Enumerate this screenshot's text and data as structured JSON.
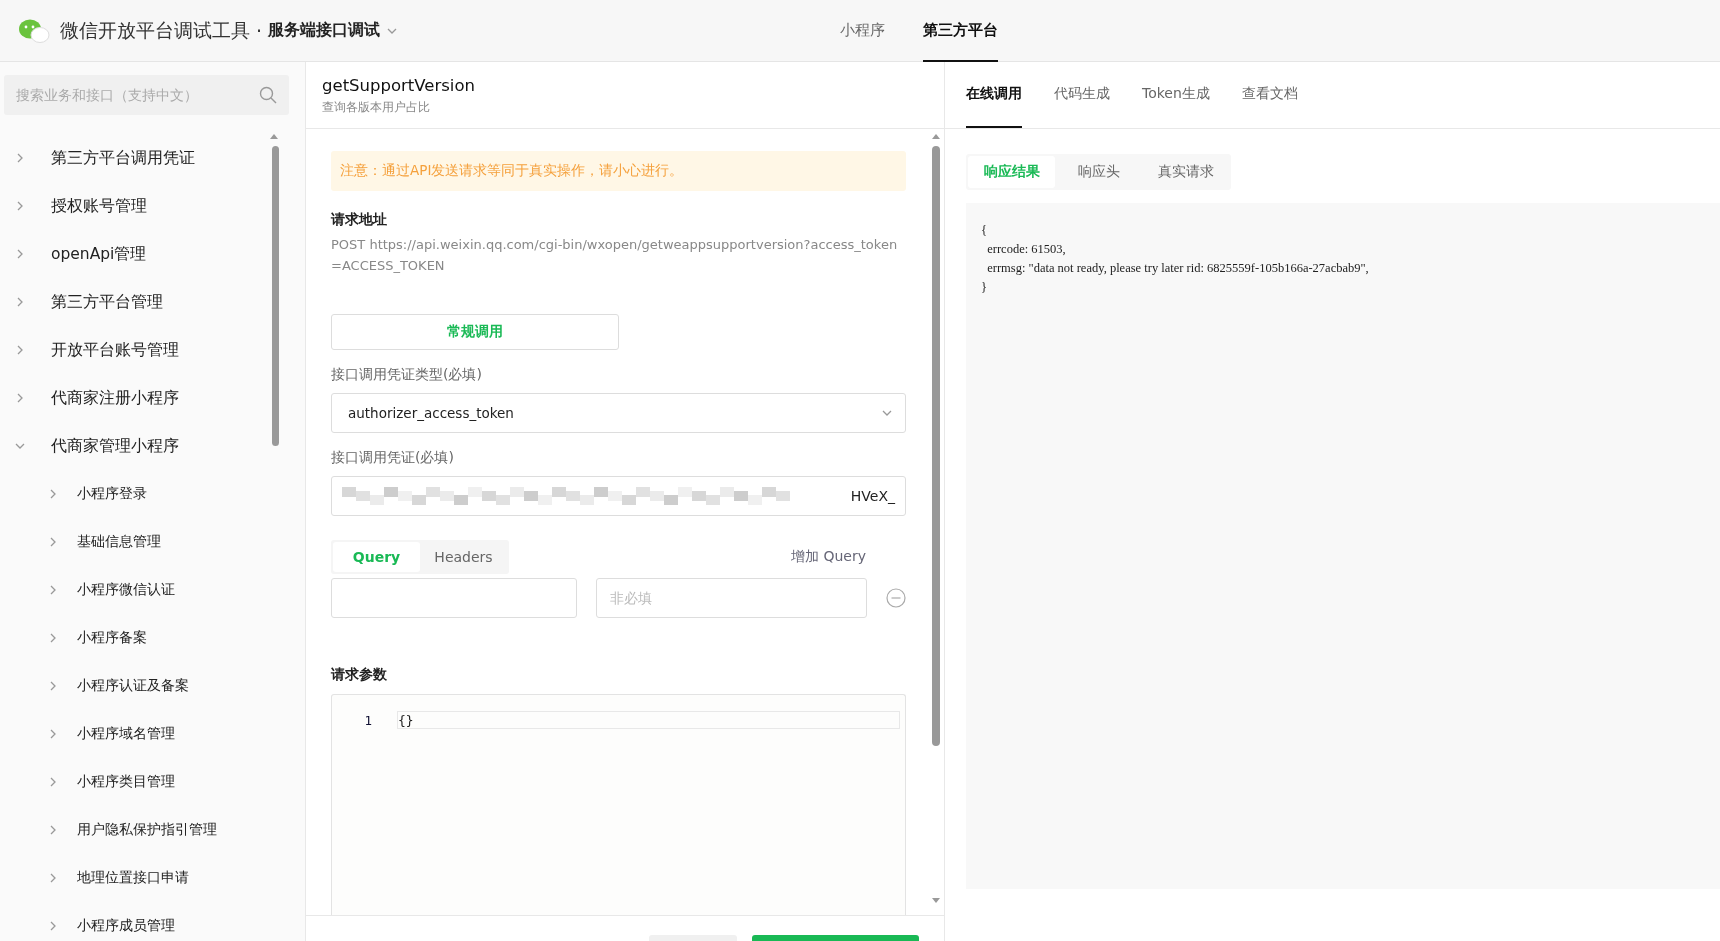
{
  "header": {
    "app_title": "微信开放平台调试工具",
    "separator": "·",
    "section": "服务端接口调试",
    "nav": [
      {
        "label": "小程序",
        "selected": false
      },
      {
        "label": "第三方平台",
        "selected": true
      }
    ]
  },
  "sidebar": {
    "search": {
      "placeholder": "搜索业务和接口（支持中文）"
    },
    "items": [
      {
        "label": "第三方平台调用凭证",
        "expanded": false
      },
      {
        "label": "授权账号管理",
        "expanded": false
      },
      {
        "label": "openApi管理",
        "expanded": false
      },
      {
        "label": "第三方平台管理",
        "expanded": false
      },
      {
        "label": "开放平台账号管理",
        "expanded": false
      },
      {
        "label": "代商家注册小程序",
        "expanded": false
      },
      {
        "label": "代商家管理小程序",
        "expanded": true,
        "children": [
          {
            "label": "小程序登录",
            "expanded": false
          },
          {
            "label": "基础信息管理",
            "expanded": false
          },
          {
            "label": "小程序微信认证",
            "expanded": false
          },
          {
            "label": "小程序备案",
            "expanded": false
          },
          {
            "label": "小程序认证及备案",
            "expanded": false
          },
          {
            "label": "小程序域名管理",
            "expanded": false
          },
          {
            "label": "小程序类目管理",
            "expanded": false
          },
          {
            "label": "用户隐私保护指引管理",
            "expanded": false
          },
          {
            "label": "地理位置接口申请",
            "expanded": false
          },
          {
            "label": "小程序成员管理",
            "expanded": false
          }
        ]
      }
    ]
  },
  "api": {
    "name": "getSupportVersion",
    "description": "查询各版本用户占比"
  },
  "request": {
    "notice": "注意：通过API发送请求等同于真实操作，请小心进行。",
    "address_label": "请求地址",
    "address": "POST https://api.weixin.qq.com/cgi-bin/wxopen/getweappsupportversion?access_token=ACCESS_TOKEN",
    "call_mode_button": "常规调用",
    "credential_type": {
      "label": "接口调用凭证类型(必填)",
      "value": "authorizer_access_token"
    },
    "credential": {
      "label": "接口调用凭证(必填)",
      "value": "HVeX_",
      "redacted": true
    },
    "param_tabs": [
      {
        "label": "Query",
        "selected": true
      },
      {
        "label": "Headers",
        "selected": false
      }
    ],
    "add_query": "增加 Query",
    "query_row": {
      "value_placeholder": "非必填"
    },
    "body_label": "请求参数",
    "body_lines": [
      {
        "number": "1",
        "code": "{}"
      }
    ]
  },
  "result": {
    "tabs": [
      {
        "label": "在线调用",
        "selected": true
      },
      {
        "label": "代码生成",
        "selected": false
      },
      {
        "label": "Token生成",
        "selected": false
      },
      {
        "label": "查看文档",
        "selected": false
      }
    ],
    "response_tabs": [
      {
        "label": "响应结果",
        "selected": true
      },
      {
        "label": "响应头",
        "selected": false
      },
      {
        "label": "真实请求",
        "selected": false
      }
    ],
    "response_lines": [
      "{",
      "  errcode: 61503,",
      "  errmsg: \"data not ready, please try later rid: 6825559f-105b166a-27acbab9\",",
      "}"
    ]
  }
}
